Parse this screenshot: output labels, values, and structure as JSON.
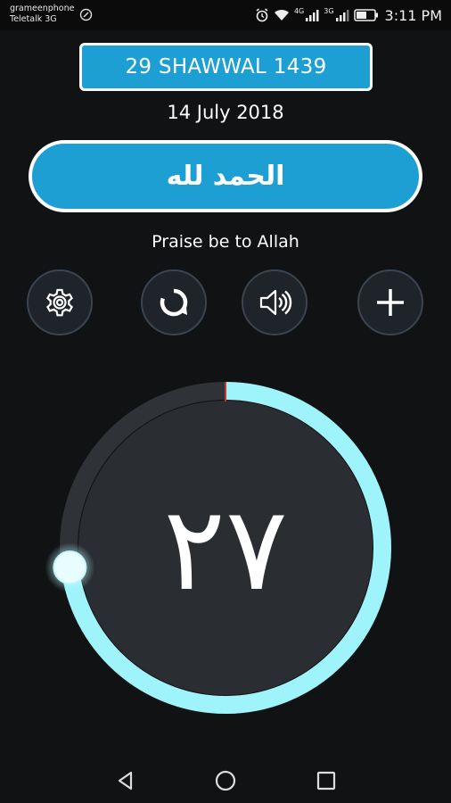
{
  "status_bar": {
    "carrier_1": "grameenphone",
    "carrier_2": "Teletalk 3G",
    "network_1": "4G",
    "network_2": "3G",
    "time": "3:11 PM",
    "icons": [
      "alarm-icon",
      "wifi-icon",
      "signal-icon",
      "battery-icon"
    ]
  },
  "header": {
    "hijri_date": "29 SHAWWAL 1439",
    "gregorian_date": "14 July 2018"
  },
  "dhikr": {
    "arabic": "الحمد لله",
    "translation": "Praise be to Allah"
  },
  "controls": [
    {
      "name": "settings-button",
      "icon": "gear-icon"
    },
    {
      "name": "reset-button",
      "icon": "refresh-icon"
    },
    {
      "name": "sound-button",
      "icon": "speaker-icon"
    },
    {
      "name": "add-button",
      "icon": "plus-icon"
    }
  ],
  "counter": {
    "display": "٢٧",
    "progress": 0.73
  },
  "nav_bar": {
    "icons": [
      "back-icon",
      "home-icon",
      "recents-icon"
    ]
  },
  "colors": {
    "accent": "#1e9fd4",
    "ring": "#9ff3fb",
    "background": "#111213",
    "button_fill": "#1f232a"
  }
}
